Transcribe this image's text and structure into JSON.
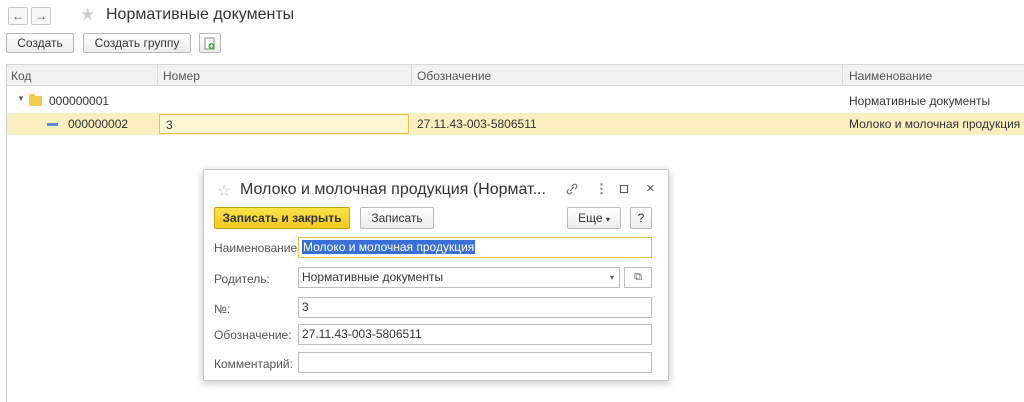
{
  "header": {
    "back_icon": "arrow-left-icon",
    "forward_icon": "arrow-right-icon",
    "title": "Нормативные документы"
  },
  "toolbar": {
    "create_label": "Создать",
    "create_group_label": "Создать группу"
  },
  "table": {
    "columns": [
      "Код",
      "Номер",
      "Обозначение",
      "Наименование"
    ],
    "rows": [
      {
        "code": "000000001",
        "number": "",
        "designation": "",
        "name": "Нормативные документы"
      },
      {
        "code": "000000002",
        "number": "3",
        "designation": "27.11.43-003-5806511",
        "name": "Молоко и молочная продукция"
      }
    ]
  },
  "dialog": {
    "title": "Молоко и молочная продукция (Нормат...",
    "save_close_label": "Записать и закрыть",
    "save_label": "Записать",
    "more_label": "Еще",
    "help_label": "?",
    "fields": {
      "name_label": "Наименование:",
      "name_value": "Молоко и молочная продукция",
      "parent_label": "Родитель:",
      "parent_value": "Нормативные документы",
      "number_label": "№:",
      "number_value": "3",
      "designation_label": "Обозначение:",
      "designation_value": "27.11.43-003-5806511",
      "comment_label": "Комментарий:",
      "comment_value": ""
    }
  },
  "colors": {
    "accent_yellow": "#f5d52a",
    "selection_row": "#fbeec0",
    "text_selection": "#3b6fd8",
    "folder": "#f2c94c"
  }
}
